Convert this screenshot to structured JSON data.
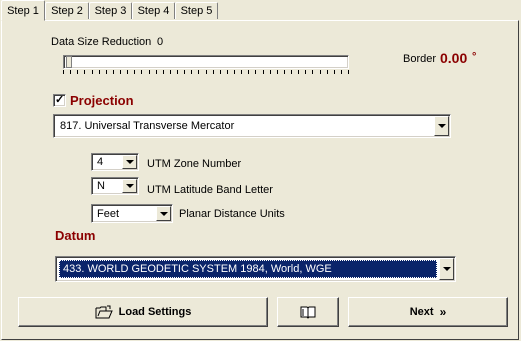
{
  "tabs": [
    {
      "label": "Step 1",
      "active": true
    },
    {
      "label": "Step 2",
      "active": false
    },
    {
      "label": "Step 3",
      "active": false
    },
    {
      "label": "Step 4",
      "active": false
    },
    {
      "label": "Step 5",
      "active": false
    }
  ],
  "data_size": {
    "label": "Data Size Reduction",
    "value": "0",
    "slider_level": 0
  },
  "border": {
    "label": "Border",
    "value": "0.00",
    "unit": "°"
  },
  "projection": {
    "checkbox_label": "Projection",
    "checked": true,
    "selected": "817. Universal Transverse Mercator"
  },
  "utm": {
    "zone_value": "4",
    "zone_label": "UTM Zone Number",
    "band_value": "N",
    "band_label": "UTM Latitude Band Letter",
    "units_value": "Feet",
    "units_label": "Planar Distance Units"
  },
  "datum": {
    "label": "Datum",
    "selected": "433. WORLD GEODETIC SYSTEM 1984,  World,  WGE"
  },
  "buttons": {
    "load_settings": "Load Settings",
    "next": "Next"
  },
  "colors": {
    "accent_red": "#8b0000",
    "selection_blue": "#0a246a",
    "face": "#ece9d8"
  }
}
